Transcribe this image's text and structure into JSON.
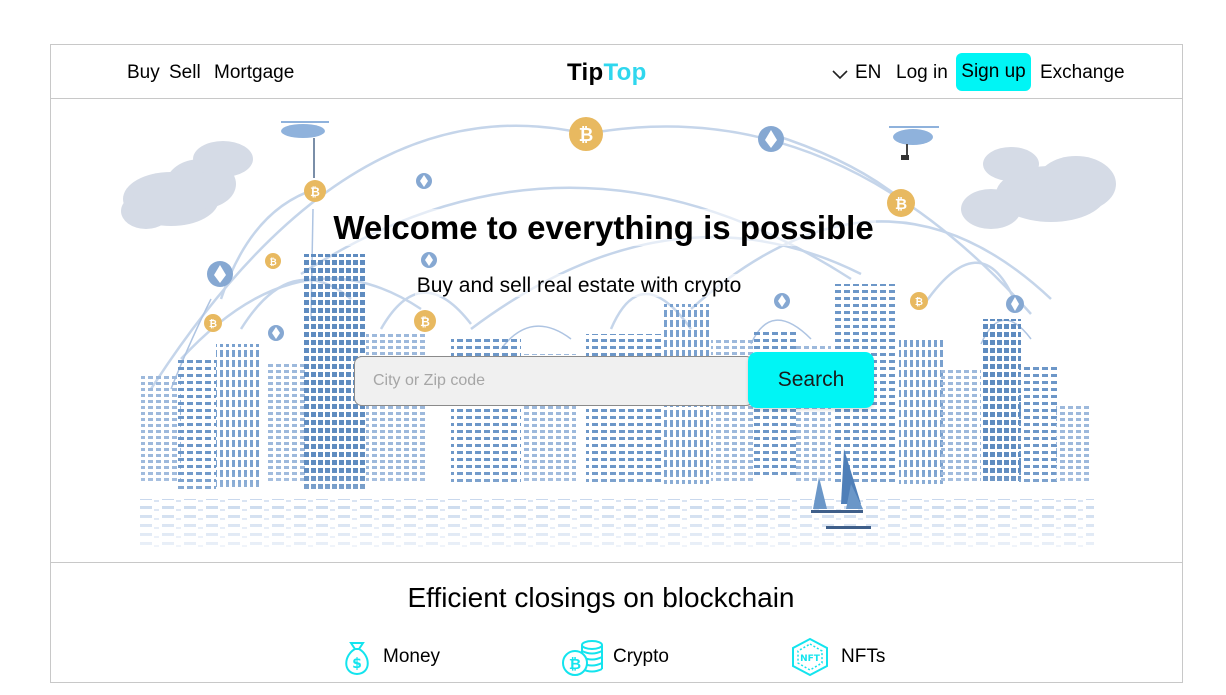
{
  "nav": {
    "left_links": [
      "Buy",
      "Sell",
      "Mortgage"
    ],
    "logo_part1": "Tip",
    "logo_part2": "Top",
    "language": "EN",
    "login_label": "Log in",
    "signup_label": "Sign up",
    "exchange_label": "Exchange"
  },
  "hero": {
    "title": "Welcome to everything is possible",
    "subtitle": "Buy and sell real estate with crypto",
    "search_placeholder": "City or Zip code",
    "search_button": "Search"
  },
  "features": {
    "title": "Efficient closings on blockchain",
    "items": [
      {
        "label": "Money",
        "icon": "money-bag-icon"
      },
      {
        "label": "Crypto",
        "icon": "crypto-coins-icon"
      },
      {
        "label": "NFTs",
        "icon": "nft-badge-icon"
      }
    ]
  },
  "colors": {
    "accent": "#00f5f5",
    "logo_accent": "#2fd7ee",
    "illustration_blue": "#6f97c6",
    "coin_gold": "#e8b960",
    "cloud": "#d5dbe6",
    "border": "#c8c8c8"
  }
}
